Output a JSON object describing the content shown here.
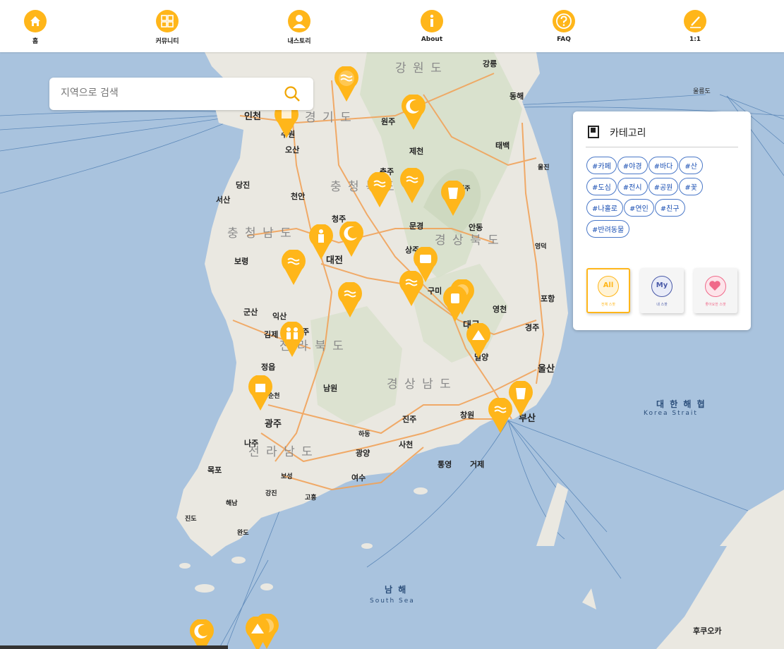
{
  "nav": [
    {
      "label": "홈",
      "icon": "home-icon"
    },
    {
      "label": "커뮤니티",
      "icon": "grid-icon"
    },
    {
      "label": "내스토리",
      "icon": "user-icon"
    },
    {
      "label": "About",
      "icon": "info-icon"
    },
    {
      "label": "FAQ",
      "icon": "question-icon"
    },
    {
      "label": "1:1",
      "icon": "pencil-icon"
    }
  ],
  "search": {
    "placeholder": "지역으로 검색",
    "icon": "search-icon"
  },
  "category": {
    "title": "카테고리",
    "icon": "book-icon",
    "tags": [
      "#카페",
      "#야경",
      "#바다",
      "#산",
      "#도심",
      "#전시",
      "#공원",
      "#꽃",
      "#나홀로",
      "#연인",
      "#친구",
      "#반려동물"
    ],
    "buttons": [
      {
        "icon_text": "All",
        "label": "전체 스팟",
        "color": "#ffb61a"
      },
      {
        "icon_text": "My",
        "label": "내 스팟",
        "color": "#4a5aa8"
      },
      {
        "icon_text": "",
        "label": "좋아요한 스팟",
        "color": "#f06a8a"
      }
    ]
  },
  "map": {
    "regions": [
      "강 원 도",
      "경 기 도",
      "충 청 북 도",
      "충 청 남 도",
      "경 상 북 도",
      "전 라 북 도",
      "경 상 남 도",
      "전 라 남 도"
    ],
    "places": [
      "강릉",
      "동해",
      "태백",
      "울진",
      "영덕",
      "포항",
      "경주",
      "울산",
      "부산",
      "창원",
      "진주",
      "사천",
      "통영",
      "거제",
      "광주",
      "나주",
      "목포",
      "대전",
      "대구",
      "구미",
      "상주",
      "문경",
      "안동",
      "영주",
      "영천",
      "밀양",
      "청주",
      "충주",
      "원주",
      "제천",
      "수원",
      "오산",
      "인천",
      "서산",
      "당진",
      "보령",
      "천안",
      "익산",
      "군산",
      "김제",
      "정읍",
      "전주",
      "남원",
      "순천",
      "여수",
      "광양",
      "하동",
      "완도",
      "진도",
      "해남",
      "강진",
      "고흥",
      "보성"
    ],
    "seas": [
      {
        "name": "대 한 해 협",
        "en": "Korea Strait"
      },
      {
        "name": "남 해",
        "en": "South Sea"
      }
    ],
    "foreign": [
      "후쿠오카",
      "울릉도"
    ],
    "marker_color": "#ffb61a"
  }
}
